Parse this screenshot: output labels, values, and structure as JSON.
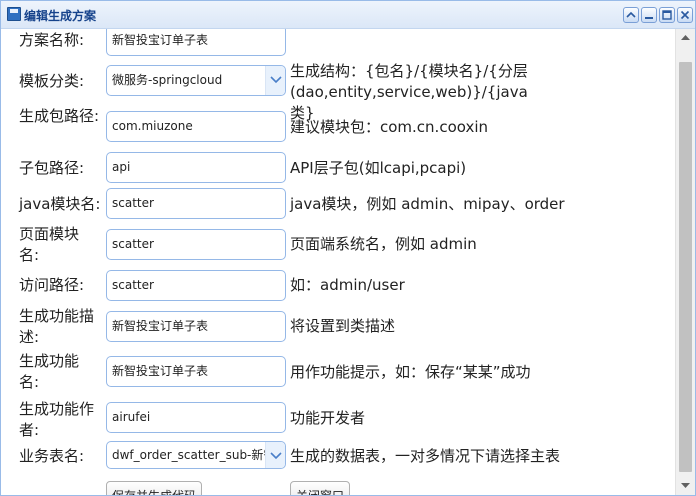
{
  "window": {
    "title": "编辑生成方案",
    "icon": "floppy-disk-icon",
    "buttons": [
      "collapse-icon",
      "minimize-icon",
      "maximize-icon",
      "close-icon"
    ]
  },
  "form": {
    "scheme_name": {
      "label": "方案名称:",
      "value": "新智投宝订单子表"
    },
    "template_category": {
      "label": "模板分类:",
      "value": "微服务-springcloud",
      "hint": "生成结构：{包名}/{模块名}/{分层(dao,entity,service,web)}/{java类}"
    },
    "package_path": {
      "label": "生成包路径:",
      "value": "com.miuzone",
      "hint": "建议模块包：com.cn.cooxin"
    },
    "sub_package": {
      "label": "子包路径:",
      "value": "api",
      "hint": "API层子包(如lcapi,pcapi)"
    },
    "java_module": {
      "label": "java模块名:",
      "value": "scatter",
      "hint": "java模块，例如 admin、mipay、order"
    },
    "page_module": {
      "label": "页面模块名:",
      "value": "scatter",
      "hint": "页面端系统名，例如 admin"
    },
    "access_path": {
      "label": "访问路径:",
      "value": "scatter",
      "hint": "如：admin/user"
    },
    "function_desc": {
      "label": "生成功能描述:",
      "value": "新智投宝订单子表",
      "hint": "将设置到类描述"
    },
    "function_name": {
      "label": "生成功能名:",
      "value": "新智投宝订单子表",
      "hint": "用作功能提示，如：保存“某某”成功"
    },
    "function_author": {
      "label": "生成功能作者:",
      "value": "airufei",
      "hint": "功能开发者"
    },
    "business_table": {
      "label": "业务表名:",
      "value": "dwf_order_scatter_sub-新智",
      "hint": "生成的数据表，一对多情况下请选择主表"
    }
  },
  "actions": {
    "save_generate": "保存并生成代码",
    "close_window": "关闭窗口"
  },
  "colors": {
    "title_text": "#15428b",
    "input_border": "#95b8e7",
    "window_border": "#99bbe8"
  }
}
